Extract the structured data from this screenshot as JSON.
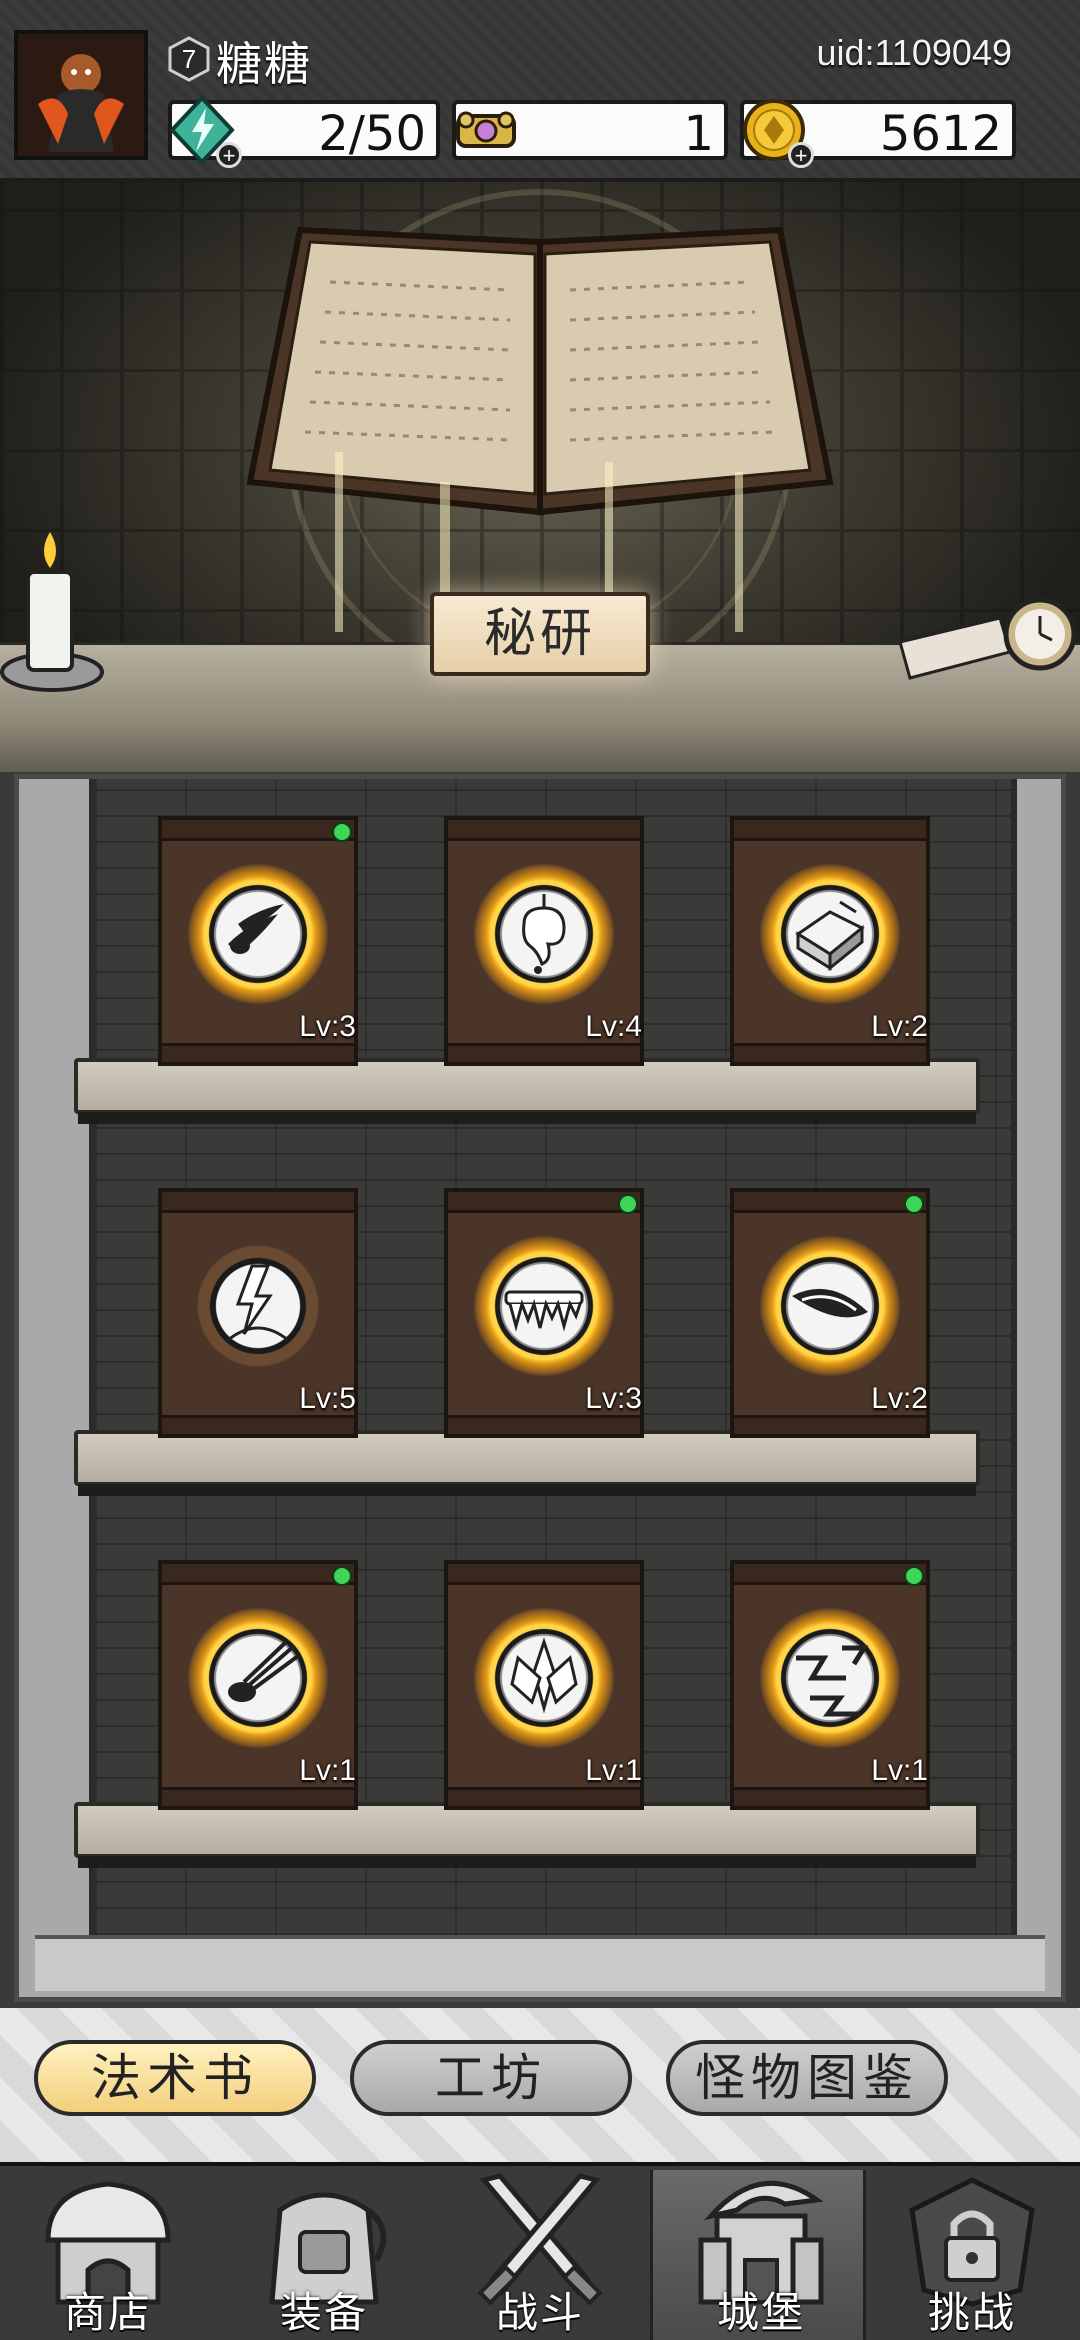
{
  "player": {
    "name": "糖糖",
    "level": "7",
    "uid": "uid:1109049"
  },
  "resources": {
    "energy": {
      "value": "2/50",
      "icon": "lightning-gem-icon"
    },
    "key": {
      "value": "1",
      "icon": "key-icon"
    },
    "coin": {
      "value": "5612",
      "icon": "gold-coin-icon"
    }
  },
  "research": {
    "label": "秘研"
  },
  "spellbooks": [
    {
      "level": "Lv:3",
      "icon": "droplets-icon",
      "has_notification": true
    },
    {
      "level": "Lv:4",
      "icon": "acid-drop-icon",
      "has_notification": false
    },
    {
      "level": "Lv:2",
      "icon": "crystal-block-icon",
      "has_notification": false
    },
    {
      "level": "Lv:5",
      "icon": "lightning-strike-icon",
      "has_notification": false
    },
    {
      "level": "Lv:3",
      "icon": "ice-spikes-icon",
      "has_notification": true
    },
    {
      "level": "Lv:2",
      "icon": "wind-slash-icon",
      "has_notification": true
    },
    {
      "level": "Lv:1",
      "icon": "meteor-icon",
      "has_notification": true
    },
    {
      "level": "Lv:1",
      "icon": "ice-crystal-icon",
      "has_notification": false
    },
    {
      "level": "Lv:1",
      "icon": "chain-lightning-icon",
      "has_notification": true
    }
  ],
  "tabs": [
    {
      "label": "法术书",
      "active": true
    },
    {
      "label": "工坊",
      "active": false
    },
    {
      "label": "怪物图鉴",
      "active": false
    }
  ],
  "nav": [
    {
      "label": "商店",
      "icon": "shop-icon"
    },
    {
      "label": "装备",
      "icon": "backpack-icon"
    },
    {
      "label": "战斗",
      "icon": "crossed-swords-icon"
    },
    {
      "label": "城堡",
      "icon": "castle-icon",
      "active": true
    },
    {
      "label": "挑战",
      "icon": "locked-challenge-icon"
    }
  ],
  "colors": {
    "notification": "#3ed45a",
    "active_tab": "#f2cf7c",
    "glow": "#ffd54a"
  }
}
